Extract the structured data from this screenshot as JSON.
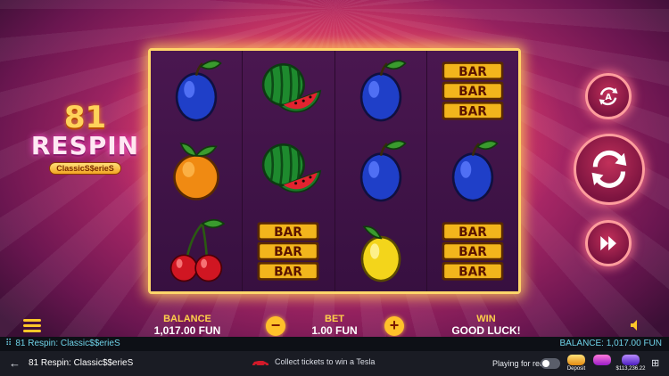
{
  "game": {
    "logo_number": "81",
    "logo_word": "RESPIN",
    "logo_sub": "ClassicS$erieS"
  },
  "reels": [
    [
      "plum",
      "orange",
      "cherries"
    ],
    [
      "watermelon",
      "watermelon",
      "bar"
    ],
    [
      "plum",
      "plum",
      "lemon"
    ],
    [
      "bar",
      "plum",
      "bar"
    ]
  ],
  "bar_label": "BAR",
  "controls": {
    "balance_label": "BALANCE",
    "balance_value": "1,017.00 FUN",
    "minus": "−",
    "bet_label": "BET",
    "bet_value": "1.00 FUN",
    "plus": "+",
    "win_label": "WIN",
    "win_value": "GOOD LUCK!"
  },
  "info_strip": {
    "game_name": "81 Respin: Classic$$erieS",
    "balance": "BALANCE: 1,017.00 FUN"
  },
  "nav": {
    "title": "81 Respin: Classic$$erieS",
    "promo_text": "Collect tickets to win a Tesla",
    "toggle_label": "Playing for real",
    "jackpot1_label": "Deposit",
    "jackpot3_amount": "$113,236.22"
  },
  "colors": {
    "plum": "#1f3fc8",
    "orange": "#f08a12",
    "cherry": "#d01622",
    "lemon": "#f3d51b",
    "watermelon": "#1e8a2e",
    "bar_gold": "#f2b51c",
    "accent": "#ffc629"
  }
}
